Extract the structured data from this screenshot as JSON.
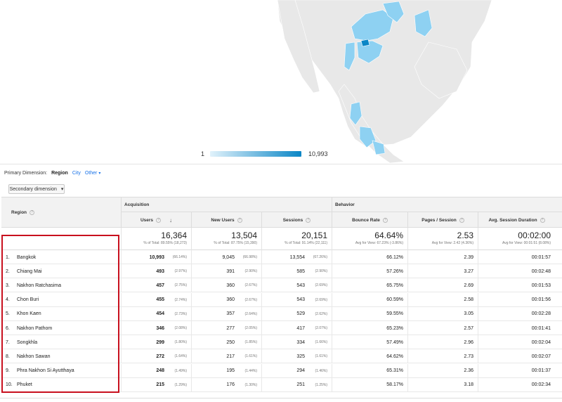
{
  "legend": {
    "min": "1",
    "max": "10,993"
  },
  "dimension": {
    "label": "Primary Dimension:",
    "options": [
      {
        "label": "Region",
        "active": true
      },
      {
        "label": "City",
        "active": false
      },
      {
        "label": "Other",
        "active": false
      }
    ],
    "caret": "▾"
  },
  "secondary": {
    "label": "Secondary dimension",
    "caret": "▾"
  },
  "table": {
    "groups": [
      "Acquisition",
      "Behavior"
    ],
    "region_header": "Region",
    "columns": [
      "Users",
      "New Users",
      "Sessions",
      "Bounce Rate",
      "Pages / Session",
      "Avg. Session Duration"
    ],
    "sort_icon": "↓",
    "help_glyph": "?",
    "totals": [
      {
        "value": "16,364",
        "sub": "% of Total: 89.55% (18,273)"
      },
      {
        "value": "13,504",
        "sub": "% of Total: 87.75% (15,390)"
      },
      {
        "value": "20,151",
        "sub": "% of Total: 91.14% (22,111)"
      },
      {
        "value": "64.64%",
        "sub": "Avg for View: 67.23% (-3.86%)"
      },
      {
        "value": "2.53",
        "sub": "Avg for View: 2.42 (4.36%)"
      },
      {
        "value": "00:02:00",
        "sub": "Avg for View: 00:01:51 (8.08%)"
      }
    ],
    "rows": [
      {
        "idx": "1.",
        "region": "Bangkok",
        "users": "10,993",
        "users_pct": "(66.14%)",
        "new": "9,045",
        "new_pct": "(66.98%)",
        "sessions": "13,554",
        "sessions_pct": "(67.26%)",
        "bounce": "66.12%",
        "pages": "2.39",
        "duration": "00:01:57"
      },
      {
        "idx": "2.",
        "region": "Chiang Mai",
        "users": "493",
        "users_pct": "(2.97%)",
        "new": "391",
        "new_pct": "(2.90%)",
        "sessions": "585",
        "sessions_pct": "(2.90%)",
        "bounce": "57.26%",
        "pages": "3.27",
        "duration": "00:02:48"
      },
      {
        "idx": "3.",
        "region": "Nakhon Ratchasima",
        "users": "457",
        "users_pct": "(2.75%)",
        "new": "360",
        "new_pct": "(2.67%)",
        "sessions": "543",
        "sessions_pct": "(2.69%)",
        "bounce": "65.75%",
        "pages": "2.69",
        "duration": "00:01:53"
      },
      {
        "idx": "4.",
        "region": "Chon Buri",
        "users": "455",
        "users_pct": "(2.74%)",
        "new": "360",
        "new_pct": "(2.67%)",
        "sessions": "543",
        "sessions_pct": "(2.69%)",
        "bounce": "60.59%",
        "pages": "2.58",
        "duration": "00:01:56"
      },
      {
        "idx": "5.",
        "region": "Khon Kaen",
        "users": "454",
        "users_pct": "(2.73%)",
        "new": "357",
        "new_pct": "(2.64%)",
        "sessions": "529",
        "sessions_pct": "(2.62%)",
        "bounce": "59.55%",
        "pages": "3.05",
        "duration": "00:02:28"
      },
      {
        "idx": "6.",
        "region": "Nakhon Pathom",
        "users": "346",
        "users_pct": "(2.08%)",
        "new": "277",
        "new_pct": "(2.05%)",
        "sessions": "417",
        "sessions_pct": "(2.07%)",
        "bounce": "65.23%",
        "pages": "2.57",
        "duration": "00:01:41"
      },
      {
        "idx": "7.",
        "region": "Songkhla",
        "users": "299",
        "users_pct": "(1.80%)",
        "new": "250",
        "new_pct": "(1.85%)",
        "sessions": "334",
        "sessions_pct": "(1.66%)",
        "bounce": "57.49%",
        "pages": "2.96",
        "duration": "00:02:04"
      },
      {
        "idx": "8.",
        "region": "Nakhon Sawan",
        "users": "272",
        "users_pct": "(1.64%)",
        "new": "217",
        "new_pct": "(1.61%)",
        "sessions": "325",
        "sessions_pct": "(1.61%)",
        "bounce": "64.62%",
        "pages": "2.73",
        "duration": "00:02:07"
      },
      {
        "idx": "9.",
        "region": "Phra Nakhon Si Ayutthaya",
        "users": "248",
        "users_pct": "(1.49%)",
        "new": "195",
        "new_pct": "(1.44%)",
        "sessions": "294",
        "sessions_pct": "(1.46%)",
        "bounce": "65.31%",
        "pages": "2.36",
        "duration": "00:01:37"
      },
      {
        "idx": "10.",
        "region": "Phuket",
        "users": "215",
        "users_pct": "(1.29%)",
        "new": "176",
        "new_pct": "(1.30%)",
        "sessions": "251",
        "sessions_pct": "(1.25%)",
        "bounce": "58.17%",
        "pages": "3.18",
        "duration": "00:02:34"
      }
    ]
  },
  "colors": {
    "highlight": "#c8101e",
    "map_active": "#8ed1f2",
    "map_top": "#0a86c6",
    "map_land": "#e8e8e8"
  }
}
